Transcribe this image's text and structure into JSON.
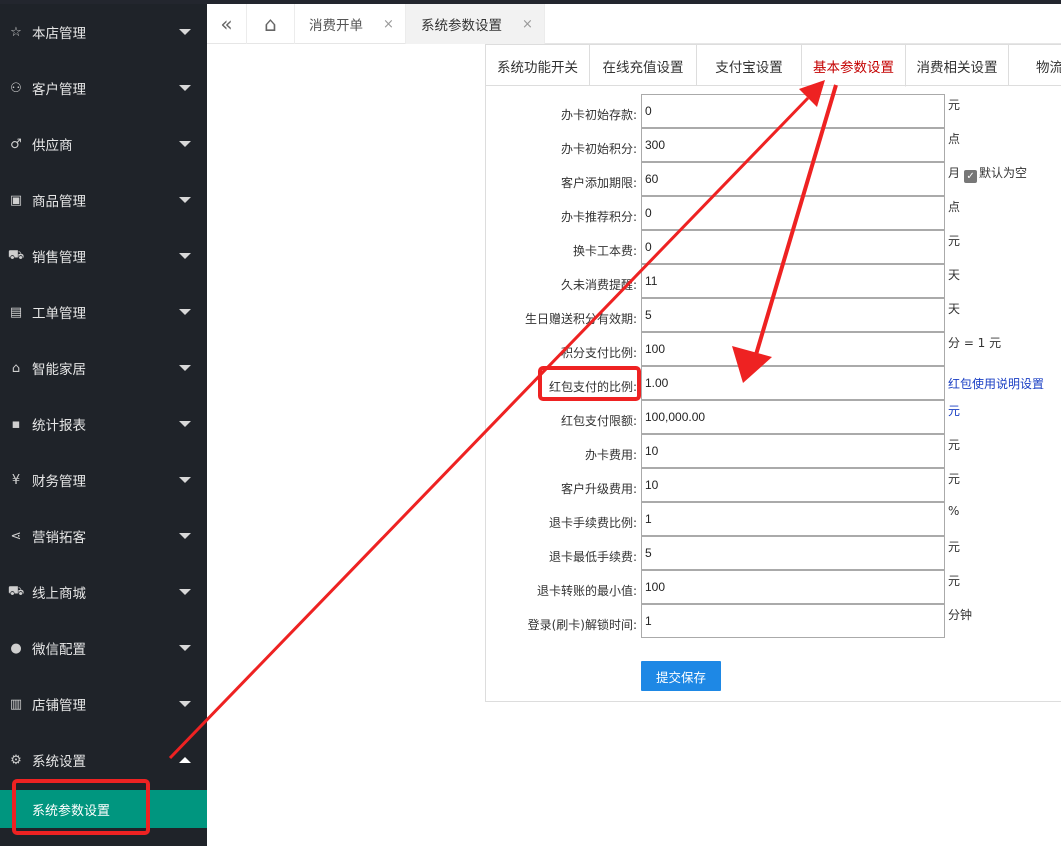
{
  "sidebar": {
    "items": [
      {
        "label": "本店管理",
        "icon": "star-icon",
        "glyph": "☆"
      },
      {
        "label": "客户管理",
        "icon": "user-icon",
        "glyph": "⚇"
      },
      {
        "label": "供应商",
        "icon": "male-icon",
        "glyph": "♂"
      },
      {
        "label": "商品管理",
        "icon": "gift-icon",
        "glyph": "▣"
      },
      {
        "label": "销售管理",
        "icon": "cart-icon",
        "glyph": "⛟"
      },
      {
        "label": "工单管理",
        "icon": "clipboard-icon",
        "glyph": "▤"
      },
      {
        "label": "智能家居",
        "icon": "home-icon",
        "glyph": "⌂"
      },
      {
        "label": "统计报表",
        "icon": "chat-icon",
        "glyph": "▪"
      },
      {
        "label": "财务管理",
        "icon": "yen-icon",
        "glyph": "¥"
      },
      {
        "label": "营销拓客",
        "icon": "share-icon",
        "glyph": "⋖"
      },
      {
        "label": "线上商城",
        "icon": "cart-icon",
        "glyph": "⛟"
      },
      {
        "label": "微信配置",
        "icon": "wechat-icon",
        "glyph": "●"
      },
      {
        "label": "店铺管理",
        "icon": "shop-icon",
        "glyph": "▥"
      },
      {
        "label": "系统设置",
        "icon": "gear-icon",
        "glyph": "⚙"
      }
    ],
    "sub_item": "系统参数设置"
  },
  "tabbar": {
    "back_glyph": "«",
    "home_glyph": "⌂",
    "close_glyph": "×",
    "tabs": [
      "消费开单",
      "系统参数设置"
    ]
  },
  "subtabs": [
    "系统功能开关",
    "在线充值设置",
    "支付宝设置",
    "基本参数设置",
    "消费相关设置",
    "物流"
  ],
  "form": {
    "rows": [
      {
        "label": "办卡初始存款:",
        "value": "0",
        "unit": "元"
      },
      {
        "label": "办卡初始积分:",
        "value": "300",
        "unit": "点"
      },
      {
        "label": "客户添加期限:",
        "value": "60",
        "unit": "月",
        "checkbox_label": "默认为空"
      },
      {
        "label": "办卡推荐积分:",
        "value": "0",
        "unit": "点"
      },
      {
        "label": "换卡工本费:",
        "value": "0",
        "unit": "元"
      },
      {
        "label": "久未消费提醒:",
        "value": "11",
        "unit": "天"
      },
      {
        "label": "生日赠送积分有效期:",
        "value": "5",
        "unit": "天"
      },
      {
        "label": "积分支付比例:",
        "value": "100",
        "unit": "分 = 1 元"
      },
      {
        "label": "红包支付的比例:",
        "value": "1.00",
        "unit": "红包使用说明设置",
        "unit_link": true
      },
      {
        "label": "红包支付限额:",
        "value": "100,000.00",
        "unit": "元",
        "unit_link": true
      },
      {
        "label": "办卡费用:",
        "value": "10",
        "unit": "元"
      },
      {
        "label": "客户升级费用:",
        "value": "10",
        "unit": "元"
      },
      {
        "label": "退卡手续费比例:",
        "value": "1",
        "unit": "%"
      },
      {
        "label": "退卡最低手续费:",
        "value": "5",
        "unit": "元"
      },
      {
        "label": "退卡转账的最小值:",
        "value": "100",
        "unit": "元"
      },
      {
        "label": "登录(刷卡)解锁时间:",
        "value": "1",
        "unit": "分钟"
      }
    ],
    "submit_label": "提交保存"
  },
  "colors": {
    "sidebar_bg": "#1f2329",
    "sidebar_active": "#00967f",
    "active_tab_text": "#c40000",
    "submit_bg": "#1e88e5",
    "annotation_red": "#ee2222"
  }
}
